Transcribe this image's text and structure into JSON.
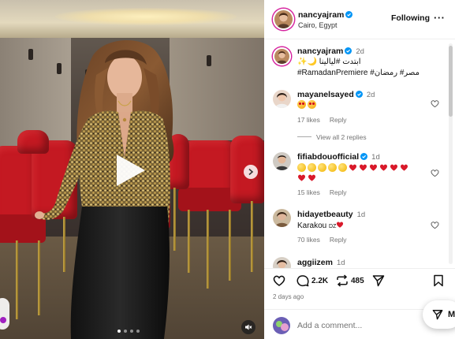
{
  "post": {
    "username": "nancyajram",
    "location": "Cairo, Egypt",
    "follow_label": "Following",
    "more_label": "···",
    "caption": {
      "username": "nancyajram",
      "time": "2d",
      "text": "ابتدت #ليالينا 🌙✨",
      "hashtags": "#RamadanPremiere #مصر# رمضان"
    },
    "posted_ago": "2 days ago"
  },
  "media": {
    "carousel_dots": 4,
    "active_dot": 0
  },
  "comments": [
    {
      "username": "mayanelsayed",
      "verified": true,
      "time": "2d",
      "emojis": [
        "heart-eyes",
        "heart-eyes"
      ],
      "likes": "17 likes",
      "reply": "Reply"
    },
    {
      "view_replies": "View all 2 replies"
    },
    {
      "username": "fifiabdouofficial",
      "verified": true,
      "time": "1d",
      "emojis_row1": [
        "ok",
        "ok",
        "ok",
        "ok",
        "ok",
        "heart",
        "heart",
        "heart",
        "heart",
        "heart",
        "heart"
      ],
      "emojis_row2": [
        "heart",
        "heart"
      ],
      "likes": "15 likes",
      "reply": "Reply"
    },
    {
      "username": "hidayetbeauty",
      "verified": false,
      "time": "1d",
      "text": "Karakou ",
      "text_suffix": "DZ",
      "likes": "70 likes",
      "reply": "Reply"
    },
    {
      "username": "aggiizem",
      "verified": false,
      "time": "1d"
    }
  ],
  "actions": {
    "comment_count": "2.2K",
    "repost_count": "485"
  },
  "add_comment": {
    "placeholder": "Add a comment..."
  },
  "message_button": {
    "label": "M"
  },
  "colors": {
    "accent": "#0095f6",
    "verified": "#0095f6",
    "heart": "#ed4956",
    "hashtag": "#00376b",
    "chair_red": "#c41922"
  }
}
